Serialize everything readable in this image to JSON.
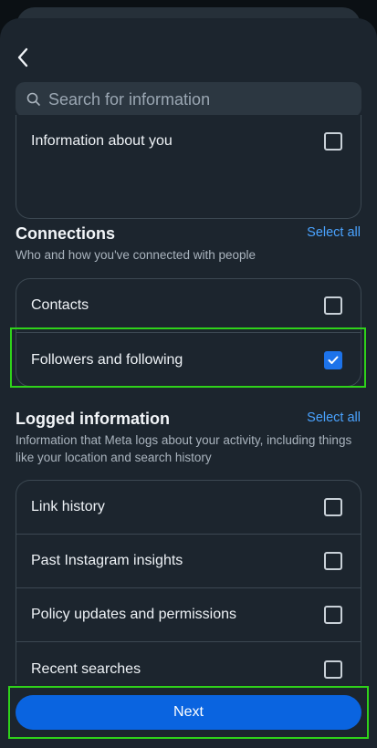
{
  "search": {
    "placeholder": "Search for information"
  },
  "top_card": {
    "items": [
      {
        "label": "Information about you",
        "checked": false
      }
    ]
  },
  "connections": {
    "title": "Connections",
    "select_all": "Select all",
    "description": "Who and how you've connected with people",
    "items": [
      {
        "label": "Contacts",
        "checked": false
      },
      {
        "label": "Followers and following",
        "checked": true
      }
    ]
  },
  "logged": {
    "title": "Logged information",
    "select_all": "Select all",
    "description": "Information that Meta logs about your activity, including things like your location and search history",
    "items": [
      {
        "label": "Link history",
        "checked": false
      },
      {
        "label": "Past Instagram insights",
        "checked": false
      },
      {
        "label": "Policy updates and permissions",
        "checked": false
      },
      {
        "label": "Recent searches",
        "checked": false
      }
    ]
  },
  "footer": {
    "next_label": "Next"
  },
  "colors": {
    "accent": "#0a64e0",
    "link": "#4aa3ff",
    "highlight": "#2fd21a",
    "background": "#1c252e"
  }
}
